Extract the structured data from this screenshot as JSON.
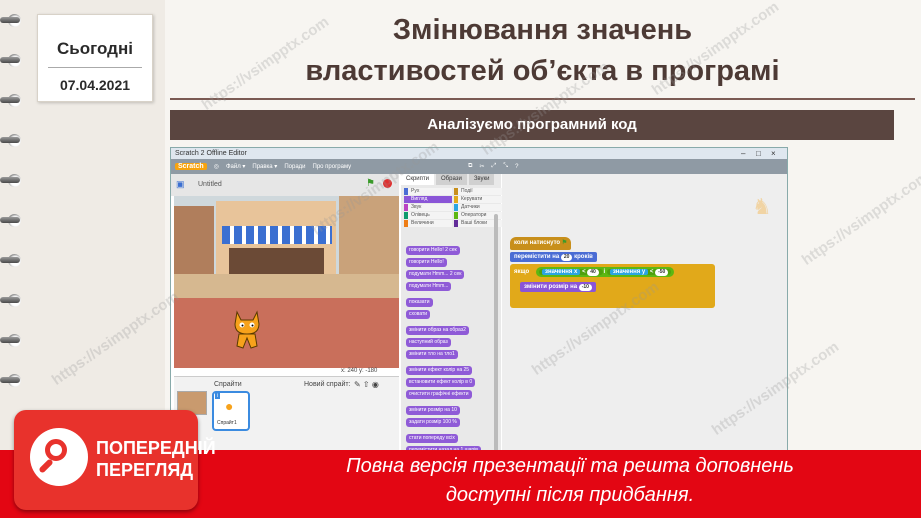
{
  "sidebar": {
    "today_label": "Сьогодні",
    "date": "07.04.2021"
  },
  "slide": {
    "title_line1": "Змінювання значень",
    "title_line2": "властивостей об’єкта в програмі",
    "banner": "Аналізуємо програмний код"
  },
  "window": {
    "title": "Scratch 2 Offline Editor",
    "menu": [
      "Файл ▾",
      "Правка ▾",
      "Поради",
      "Про програму"
    ],
    "project_title": "Untitled",
    "coords": "x: 240  y: -180",
    "sprites_label": "Спрайти",
    "new_sprite_label": "Новий спрайт:",
    "sprite_name": "Спрайт1",
    "tabs": [
      "Скрипти",
      "Образи",
      "Звуки"
    ],
    "categories": [
      "Рух",
      "Події",
      "Вигляд",
      "Керувати",
      "Звук",
      "Датчики",
      "Олівець",
      "Оператори",
      "Величини",
      "Ваші блоки"
    ],
    "palette_blocks": [
      "говорити Hello! 2 сек",
      "говорити Hello!",
      "подумати Hmm... 2 сек",
      "подумати Hmm...",
      "показати",
      "сховати",
      "змінити образ на образ2",
      "наступний образ",
      "змінити тло на тло1",
      "змінити ефект колір на 25",
      "встановити ефект колір в 0",
      "очистити графічні ефекти",
      "змінити розмір на 10",
      "задати розмір 100 %",
      "стати попереду всіх",
      "перемістити назад на 1 шарів"
    ]
  },
  "script": {
    "hat": "коли натиснуто",
    "move_label": "перемістити на",
    "move_value": "20",
    "move_unit": "кроків",
    "if_label": "якщо",
    "cond1_label": "значення",
    "cond1_var": "x",
    "cond1_op": "<",
    "cond1_value": "40",
    "and_label": "і",
    "cond2_label": "значення",
    "cond2_var": "y",
    "cond2_op": "<",
    "cond2_value": "-50",
    "resize_label": "змінити розмір на",
    "resize_value": "-10"
  },
  "watermark": "https://vsimpptx.com",
  "preview": {
    "line1": "ПОПЕРЕДНІЙ",
    "line2": "ПЕРЕГЛЯД"
  },
  "footer": {
    "line1": "Повна версія презентації та решта доповнень",
    "line2": "доступні після придбання."
  },
  "colors": {
    "footer": "#e30613",
    "title": "#4d3a35",
    "banner": "#5a4540"
  }
}
